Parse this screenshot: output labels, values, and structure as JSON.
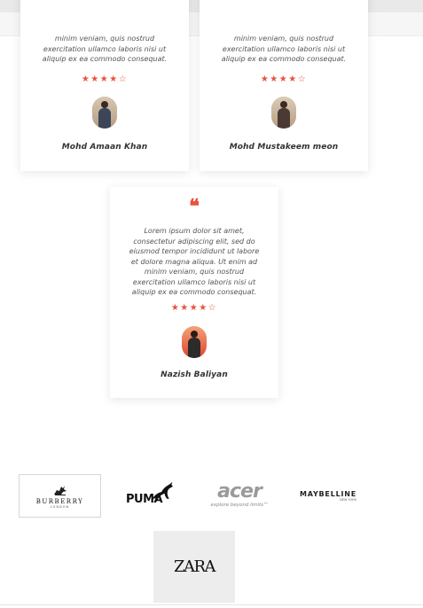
{
  "testimonials": [
    {
      "text": "minim veniam, quis nostrud exercitation ullamco laboris nisi ut aliquip ex ea commodo consequat.",
      "stars": "★★★★☆",
      "rating": 4,
      "name": "Mohd Amaan Khan"
    },
    {
      "text": "minim veniam, quis nostrud exercitation ullamco laboris nisi ut aliquip ex ea commodo consequat.",
      "stars": "★★★★☆",
      "rating": 4,
      "name": "Mohd Mustakeem meon"
    },
    {
      "quote_mark": "❝",
      "text": "Lorem ipsum dolor sit amet, consectetur adipiscing elit, sed do eiusmod tempor incididunt ut labore et dolore magna aliqua. Ut enim ad minim veniam, quis nostrud exercitation ullamco laboris nisi ut aliquip ex ea commodo consequat.",
      "stars": "★★★★☆",
      "rating": 4,
      "name": "Nazish Baliyan"
    }
  ],
  "brands": {
    "burberry": {
      "name": "BURBERRY",
      "sub": "LONDON"
    },
    "puma": {
      "name": "PUMA"
    },
    "acer": {
      "name": "acer",
      "tagline": "explore beyond limits™"
    },
    "maybelline": {
      "name": "MAYBELLINE",
      "sub": "NEW YORK"
    },
    "zara": {
      "name": "ZARA"
    }
  },
  "colors": {
    "accent": "#e8523f",
    "text": "#555555",
    "name_text": "#333333"
  },
  "icons": [
    "quote-icon",
    "star-icon",
    "puma-cat-icon",
    "burberry-knight-icon"
  ]
}
